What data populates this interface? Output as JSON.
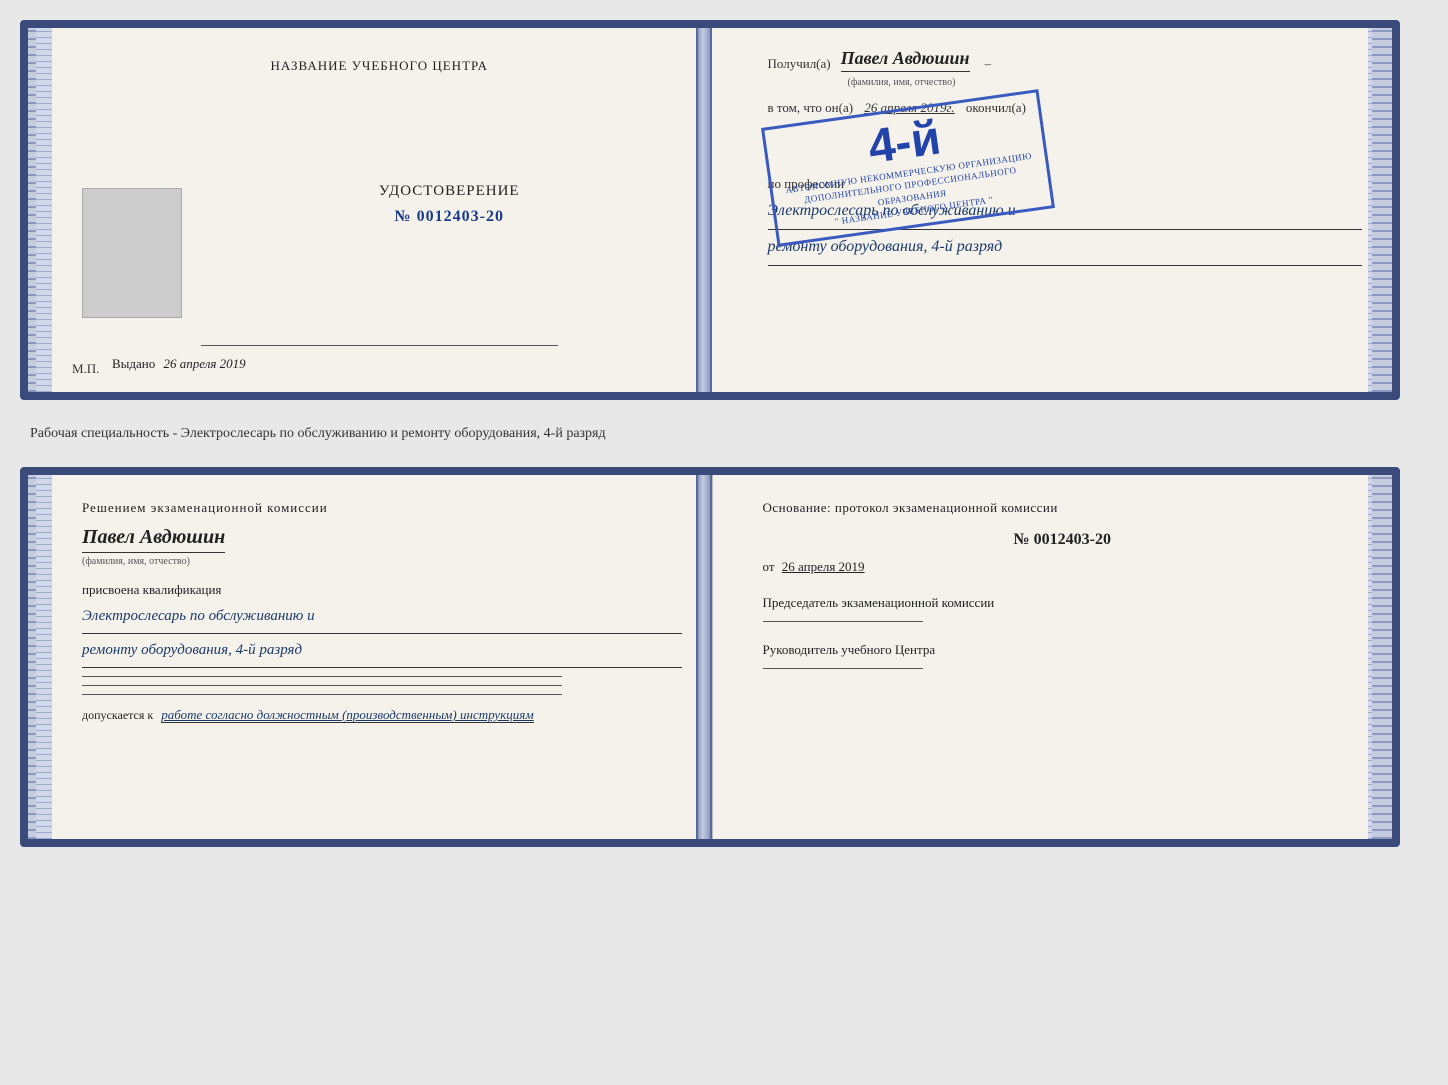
{
  "top_document": {
    "left": {
      "center_title": "НАЗВАНИЕ УЧЕБНОГО ЦЕНТРА",
      "cert_label": "УДОСТОВЕРЕНИЕ",
      "cert_number": "№ 0012403-20",
      "issued_label": "Выдано",
      "issued_date": "26 апреля 2019",
      "mp_label": "М.П."
    },
    "right": {
      "received_label": "Получил(а)",
      "received_name": "Павел Авдюшин",
      "fio_hint": "(фамилия, имя, отчество)",
      "in_that_label": "в том, что он(а)",
      "in_that_date": "26 апреля 2019г.",
      "finished_label": "окончил(а)",
      "stamp": {
        "grade": "4-й",
        "line1": "АВТОНОМНУЮ НЕКОММЕРЧЕСКУЮ ОРГАНИЗАЦИЮ",
        "line2": "ДОПОЛНИТЕЛЬНОГО ПРОФЕССИОНАЛЬНОГО ОБРАЗОВАНИЯ",
        "line3": "\" НАЗВАНИЕ УЧЕБНОГО ЦЕНТРА \""
      },
      "profession_label": "по профессии",
      "profession_text_line1": "Электрослесарь по обслуживанию и",
      "profession_text_line2": "ремонту оборудования, 4-й разряд"
    }
  },
  "middle_text": "Рабочая специальность - Электрослесарь по обслуживанию и ремонту оборудования, 4-й разряд",
  "bottom_document": {
    "left": {
      "decision_title": "Решением экзаменационной комиссии",
      "person_name": "Павел Авдюшин",
      "fio_hint": "(фамилия, имя, отчество)",
      "assigned_label": "присвоена квалификация",
      "qual_line1": "Электрослесарь по обслуживанию и",
      "qual_line2": "ремонту оборудования, 4-й разряд",
      "allowed_label": "допускается к",
      "allowed_text": "работе согласно должностным (производственным) инструкциям"
    },
    "right": {
      "basis_label": "Основание: протокол экзаменационной комиссии",
      "protocol_number": "№ 0012403-20",
      "protocol_date_label": "от",
      "protocol_date": "26 апреля 2019",
      "chairman_label": "Председатель экзаменационной комиссии",
      "director_label": "Руководитель учебного Центра"
    }
  }
}
